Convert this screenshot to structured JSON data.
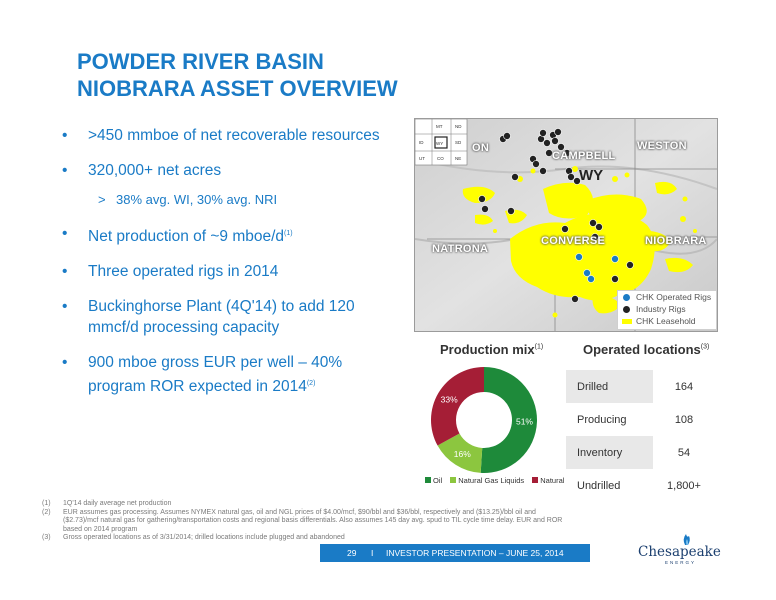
{
  "title": {
    "line1": "POWDER RIVER BASIN",
    "line2": "NIOBRARA ASSET OVERVIEW"
  },
  "bullets": [
    {
      "text": ">450 mmboe of net recoverable resources",
      "marker": "•"
    },
    {
      "text": "320,000+ net acres",
      "marker": "•"
    },
    {
      "text": "38% avg. WI, 30% avg. NRI",
      "marker": ">"
    },
    {
      "text": "Net production of ~9 mboe/d",
      "sup": "(1)",
      "marker": "•"
    },
    {
      "text": "Three operated rigs in 2014",
      "marker": "•"
    },
    {
      "text": "Buckinghorse Plant (4Q'14) to add 120 mmcf/d processing capacity",
      "marker": "•"
    },
    {
      "text": "900 mboe gross EUR per well – 40% program ROR expected in 2014",
      "sup": "(2)",
      "marker": "•"
    }
  ],
  "map": {
    "labels": {
      "on": "ON",
      "campbell": "CAMPBELL",
      "weston": "WESTON",
      "wy": "WY",
      "natrona": "NATRONA",
      "converse": "CONVERSE",
      "niobrara": "NIOBRARA"
    },
    "inset_labels": [
      "MT",
      "ND",
      "SD",
      "WY",
      "NE",
      "ID",
      "UT",
      "CO"
    ],
    "legend": [
      {
        "label": "CHK Operated Rigs",
        "color": "#1a7bc6"
      },
      {
        "label": "Industry Rigs",
        "color": "#222222"
      },
      {
        "label": "CHK Leasehold",
        "color": "#ffff00"
      }
    ]
  },
  "production_mix": {
    "title": "Production mix",
    "sup": "(1)",
    "legend_labels": [
      "Oil",
      "Natural Gas Liquids",
      "Natural Gas"
    ]
  },
  "chart_data": {
    "type": "pie",
    "categories": [
      "Oil",
      "Natural Gas Liquids",
      "Natural Gas"
    ],
    "values": [
      51,
      16,
      33
    ],
    "value_labels": [
      "51%",
      "16%",
      "33%"
    ],
    "colors": [
      "#1e8a3a",
      "#8cc63f",
      "#a51e36"
    ],
    "title": "Production mix",
    "donut": true,
    "legend": "bottom"
  },
  "operated_locations": {
    "title": "Operated locations",
    "sup": "(3)",
    "rows": [
      {
        "label": "Drilled",
        "value": "164"
      },
      {
        "label": "Producing",
        "value": "108"
      },
      {
        "label": "Inventory",
        "value": "54"
      },
      {
        "label": "Undrilled",
        "value": "1,800+"
      }
    ]
  },
  "footnotes": [
    {
      "num": "(1)",
      "text": "1Q'14 daily average net production"
    },
    {
      "num": "(2)",
      "text": "EUR assumes gas processing. Assumes NYMEX natural gas, oil and NGL prices of $4.00/mcf, $90/bbl and $36/bbl, respectively and ($13.25)/bbl oil and ($2.73)/mcf natural gas for gathering/transportation costs and regional basis differentials. Also assumes 145 day avg. spud to TIL cycle time delay. EUR and ROR based on 2014 program"
    },
    {
      "num": "(3)",
      "text": "Gross operated locations as of 3/31/2014; drilled locations include plugged and abandoned"
    }
  ],
  "footer": {
    "page": "29",
    "separator": "I",
    "text": "INVESTOR PRESENTATION – JUNE 25, 2014"
  },
  "logo": {
    "name": "Chesapeake",
    "sub": "ENERGY"
  }
}
